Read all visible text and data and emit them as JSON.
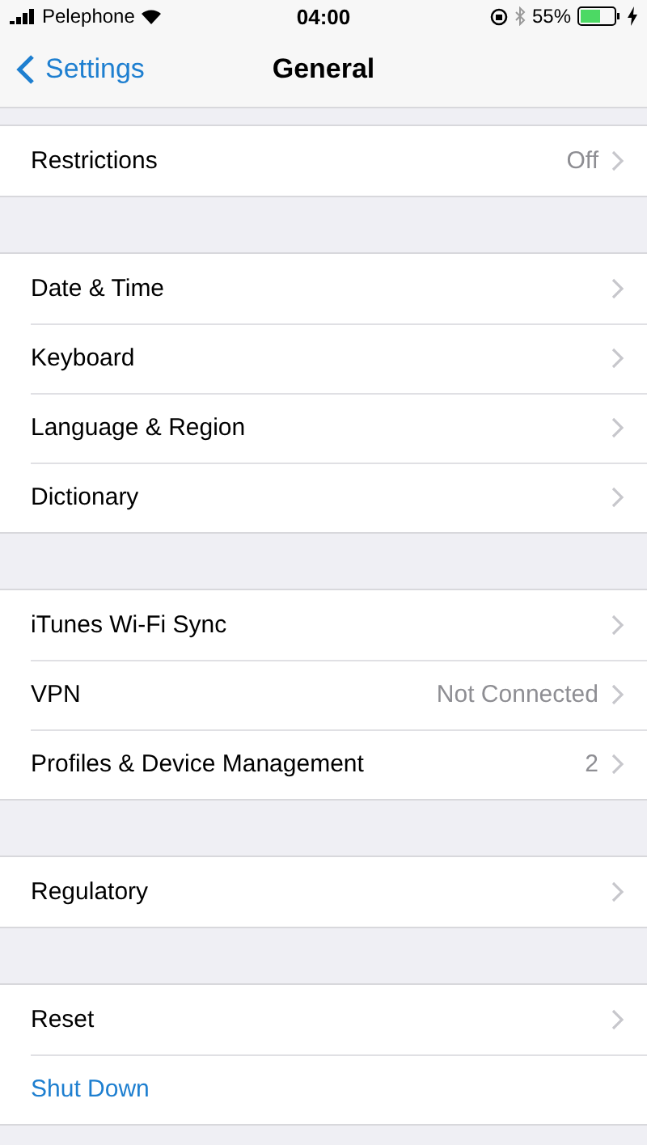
{
  "status_bar": {
    "carrier": "Pelephone",
    "time": "04:00",
    "battery": "55%"
  },
  "nav": {
    "back": "Settings",
    "title": "General"
  },
  "groups": [
    {
      "rows": [
        {
          "kind": "link",
          "label": "Restrictions",
          "value": "Off"
        }
      ]
    },
    {
      "rows": [
        {
          "kind": "link",
          "label": "Date & Time"
        },
        {
          "kind": "link",
          "label": "Keyboard"
        },
        {
          "kind": "link",
          "label": "Language & Region"
        },
        {
          "kind": "link",
          "label": "Dictionary"
        }
      ]
    },
    {
      "rows": [
        {
          "kind": "link",
          "label": "iTunes Wi-Fi Sync"
        },
        {
          "kind": "link",
          "label": "VPN",
          "value": "Not Connected"
        },
        {
          "kind": "link",
          "label": "Profiles & Device Management",
          "value": "2"
        }
      ]
    },
    {
      "rows": [
        {
          "kind": "link",
          "label": "Regulatory"
        }
      ]
    },
    {
      "rows": [
        {
          "kind": "link",
          "label": "Reset"
        },
        {
          "kind": "action",
          "label": "Shut Down"
        }
      ]
    }
  ]
}
